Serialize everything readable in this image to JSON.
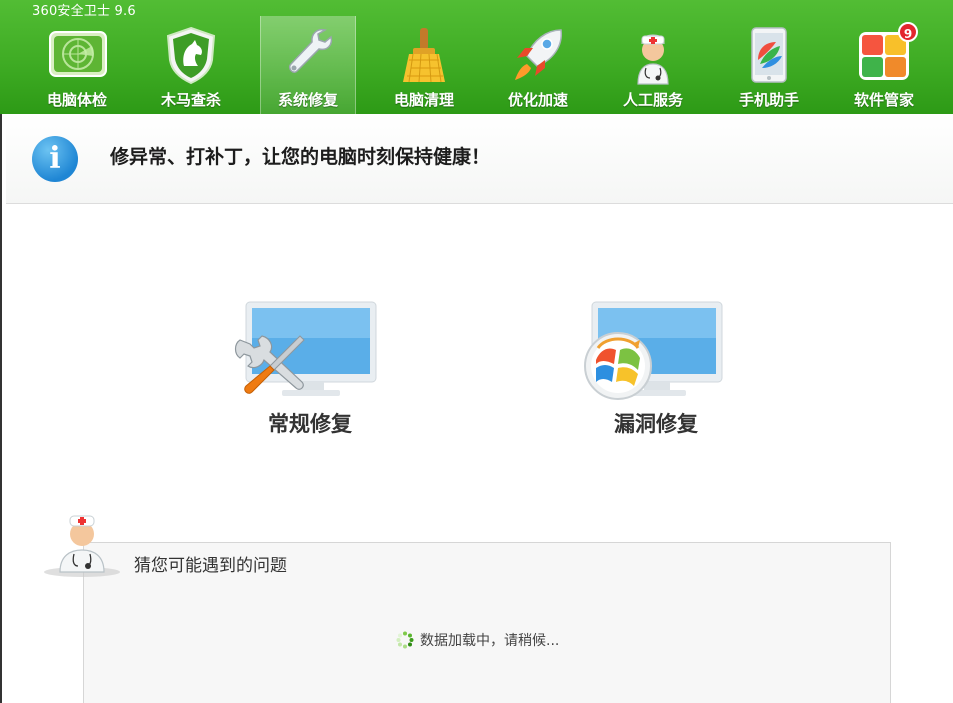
{
  "app": {
    "title": "360安全卫士 9.6"
  },
  "nav": [
    {
      "id": "checkup",
      "label": "电脑体检",
      "icon": "radar-icon",
      "active": false
    },
    {
      "id": "trojan",
      "label": "木马查杀",
      "icon": "horse-shield-icon",
      "active": false
    },
    {
      "id": "repair",
      "label": "系统修复",
      "icon": "wrench-icon",
      "active": true
    },
    {
      "id": "clean",
      "label": "电脑清理",
      "icon": "broom-icon",
      "active": false
    },
    {
      "id": "speed",
      "label": "优化加速",
      "icon": "rocket-icon",
      "active": false
    },
    {
      "id": "service",
      "label": "人工服务",
      "icon": "doctor-icon",
      "active": false
    },
    {
      "id": "phone",
      "label": "手机助手",
      "icon": "phone-icon",
      "active": false
    },
    {
      "id": "software",
      "label": "软件管家",
      "icon": "software-grid-icon",
      "active": false,
      "badge": "9"
    }
  ],
  "banner": {
    "text": "修异常、打补丁，让您的电脑时刻保持健康！",
    "icon": "info-icon"
  },
  "options": [
    {
      "id": "regular",
      "label": "常规修复",
      "icon": "monitor-tools-icon"
    },
    {
      "id": "vuln",
      "label": "漏洞修复",
      "icon": "monitor-windows-patch-icon"
    }
  ],
  "problems": {
    "title": "猜您可能遇到的问题",
    "loading": "数据加载中，请稍候..."
  },
  "colors": {
    "toolbar_green": "#3fac24",
    "info_blue": "#1f86d4",
    "badge_red": "#e3262e"
  }
}
